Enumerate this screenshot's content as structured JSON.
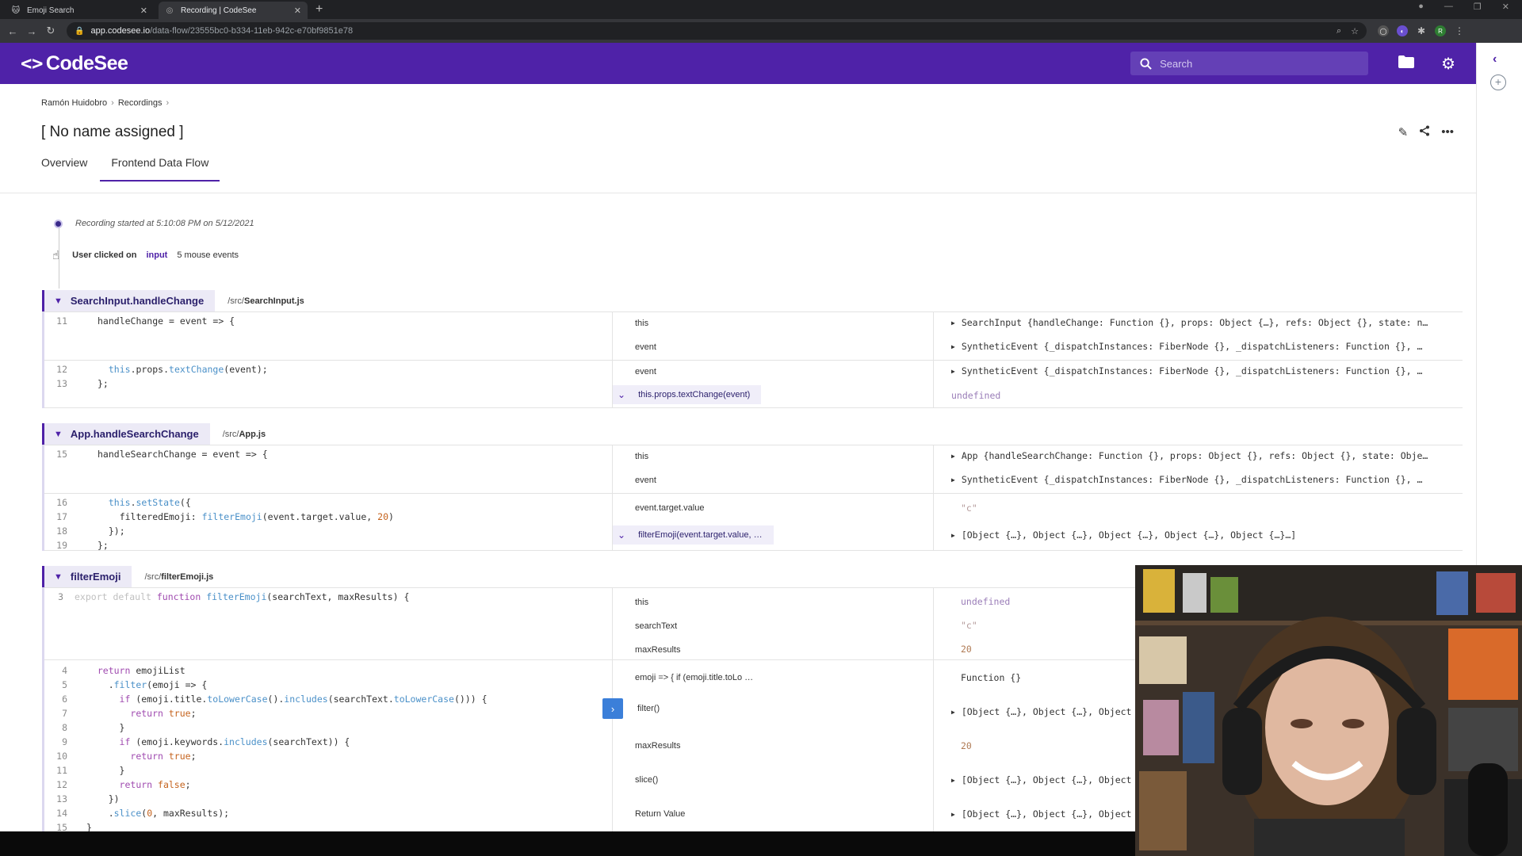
{
  "browser": {
    "tabs": [
      {
        "title": "Emoji Search",
        "active": false
      },
      {
        "title": "Recording | CodeSee",
        "active": true
      }
    ],
    "url_host": "app.codesee.io",
    "url_path": "/data-flow/23555bc0-b334-11eb-942c-e70bf9851e78"
  },
  "app": {
    "brand": "CodeSee",
    "search_placeholder": "Search",
    "colors": {
      "brand": "#4f22a8",
      "accent": "#3b7fd9"
    }
  },
  "breadcrumb": [
    "Ramón Huidobro",
    "Recordings"
  ],
  "page_title": "[ No name assigned ]",
  "tabs": [
    "Overview",
    "Frontend Data Flow"
  ],
  "timeline": {
    "start": "Recording started at 5:10:08 PM on 5/12/2021",
    "click_prefix": "User clicked on",
    "click_target": "input",
    "click_detail": "5 mouse events"
  },
  "blocks": [
    {
      "name": "SearchInput.handleChange",
      "file_dir": "/src/",
      "file_name": "SearchInput.js",
      "segments": [
        {
          "lines": [
            {
              "n": "11",
              "t": "handleChange = event => {"
            }
          ],
          "vars": [
            "this",
            "event"
          ],
          "vals": [
            "SearchInput {handleChange: Function {}, props: Object {…}, refs: Object {}, state: n…",
            "SyntheticEvent {_dispatchInstances: FiberNode {}, _dispatchListeners: Function {}, …"
          ]
        },
        {
          "lines": [
            {
              "n": "12",
              "t": "  this.props.textChange(event);"
            },
            {
              "n": "13",
              "t": "};"
            }
          ],
          "vars": [
            "event",
            "this.props.textChange(event)"
          ],
          "vals": [
            "SyntheticEvent {_dispatchInstances: FiberNode {}, _dispatchListeners: Function {}, …",
            "undefined"
          ]
        }
      ]
    },
    {
      "name": "App.handleSearchChange",
      "file_dir": "/src/",
      "file_name": "App.js",
      "segments": [
        {
          "lines": [
            {
              "n": "15",
              "t": "handleSearchChange = event => {"
            }
          ],
          "vars": [
            "this",
            "event"
          ],
          "vals": [
            "App {handleSearchChange: Function {}, props: Object {}, refs: Object {}, state: Obje…",
            "SyntheticEvent {_dispatchInstances: FiberNode {}, _dispatchListeners: Function {}, …"
          ]
        },
        {
          "lines": [
            {
              "n": "16",
              "t": "  this.setState({"
            },
            {
              "n": "17",
              "t": "    filteredEmoji: filterEmoji(event.target.value, 20)"
            },
            {
              "n": "18",
              "t": "  });"
            },
            {
              "n": "19",
              "t": "};"
            }
          ],
          "vars": [
            "event.target.value",
            "filterEmoji(event.target.value, …"
          ],
          "vals": [
            "\"c\"",
            "[Object {…}, Object {…}, Object {…}, Object {…}, Object {…}…]"
          ]
        }
      ]
    },
    {
      "name": "filterEmoji",
      "file_dir": "/src/",
      "file_name": "filterEmoji.js",
      "segments": [
        {
          "lines": [
            {
              "n": "3",
              "t": "export default function filterEmoji(searchText, maxResults) {"
            }
          ],
          "vars": [
            "this",
            "searchText",
            "maxResults"
          ],
          "vals": [
            "undefined",
            "\"c\"",
            "20"
          ]
        },
        {
          "lines": [
            {
              "n": "4",
              "t": "  return emojiList"
            },
            {
              "n": "5",
              "t": "    .filter(emoji => {"
            },
            {
              "n": "6",
              "t": "      if (emoji.title.toLowerCase().includes(searchText.toLowerCase())) {"
            },
            {
              "n": "7",
              "t": "        return true;"
            },
            {
              "n": "8",
              "t": "      }"
            },
            {
              "n": "9",
              "t": "      if (emoji.keywords.includes(searchText)) {"
            },
            {
              "n": "10",
              "t": "        return true;"
            },
            {
              "n": "11",
              "t": "      }"
            },
            {
              "n": "12",
              "t": "      return false;"
            },
            {
              "n": "13",
              "t": "    })"
            },
            {
              "n": "14",
              "t": "    .slice(0, maxResults);"
            },
            {
              "n": "15",
              "t": "}"
            }
          ],
          "vars": [
            "emoji => { if (emoji.title.toLo …",
            "filter()",
            "maxResults",
            "slice()",
            "Return Value"
          ],
          "vals": [
            "Function {}",
            "[Object {…}, Object {…}, Object",
            "20",
            "[Object {…}, Object {…}, Object",
            "[Object {…}, Object {…}, Object"
          ]
        }
      ]
    }
  ]
}
